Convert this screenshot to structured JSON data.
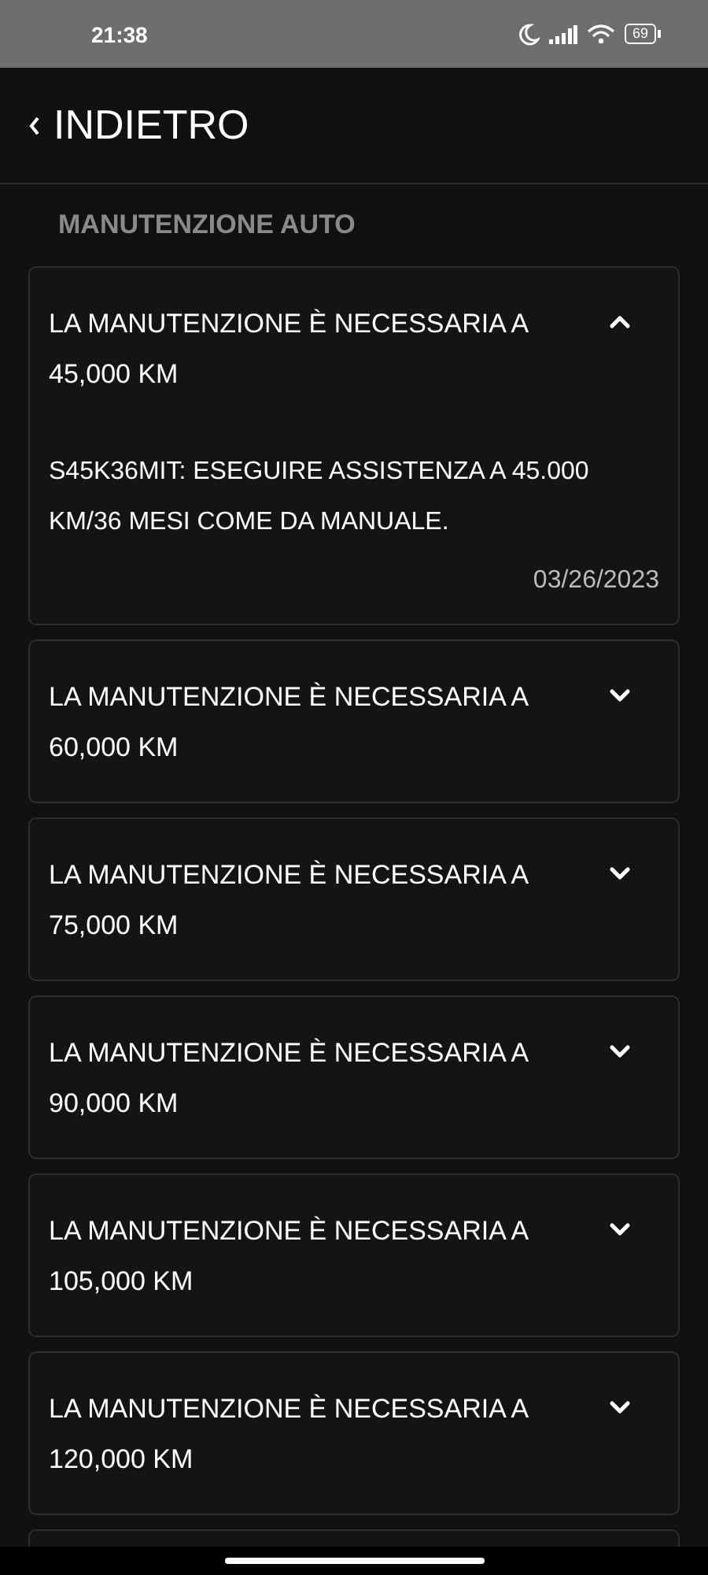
{
  "status_bar": {
    "time": "21:38",
    "battery": "69"
  },
  "header": {
    "back_label": "INDIETRO"
  },
  "section_title": "MANUTENZIONE AUTO",
  "items": [
    {
      "title": "LA MANUTENZIONE È NECESSARIA A 45,000 KM",
      "expanded": true,
      "detail": "S45K36MIT: ESEGUIRE ASSISTENZA A 45.000 KM/36 MESI COME DA MANUALE.",
      "date": "03/26/2023"
    },
    {
      "title": "LA MANUTENZIONE È NECESSARIA A 60,000 KM",
      "expanded": false
    },
    {
      "title": "LA MANUTENZIONE È NECESSARIA A 75,000 KM",
      "expanded": false
    },
    {
      "title": "LA MANUTENZIONE È NECESSARIA A 90,000 KM",
      "expanded": false
    },
    {
      "title": "LA MANUTENZIONE È NECESSARIA A 105,000 KM",
      "expanded": false
    },
    {
      "title": "LA MANUTENZIONE È NECESSARIA A 120,000 KM",
      "expanded": false
    }
  ]
}
